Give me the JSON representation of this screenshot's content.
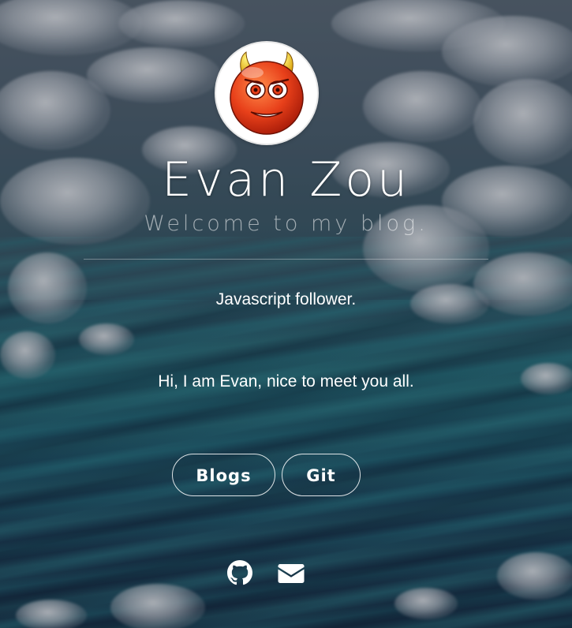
{
  "profile": {
    "name": "Evan Zou",
    "subtitle": "Welcome to my blog.",
    "avatar_icon": "devil-emoji-icon"
  },
  "tagline": "Javascript follower.",
  "intro": "Hi, I am Evan, nice to meet you all.",
  "buttons": [
    {
      "label": "Blogs"
    },
    {
      "label": "Git"
    }
  ],
  "social": [
    {
      "icon": "github-icon"
    },
    {
      "icon": "mail-icon"
    }
  ],
  "colors": {
    "text": "#ffffff",
    "subtitle": "#b9c1c8",
    "avatar_red": "#e8401a",
    "avatar_horn": "#f5c518"
  }
}
